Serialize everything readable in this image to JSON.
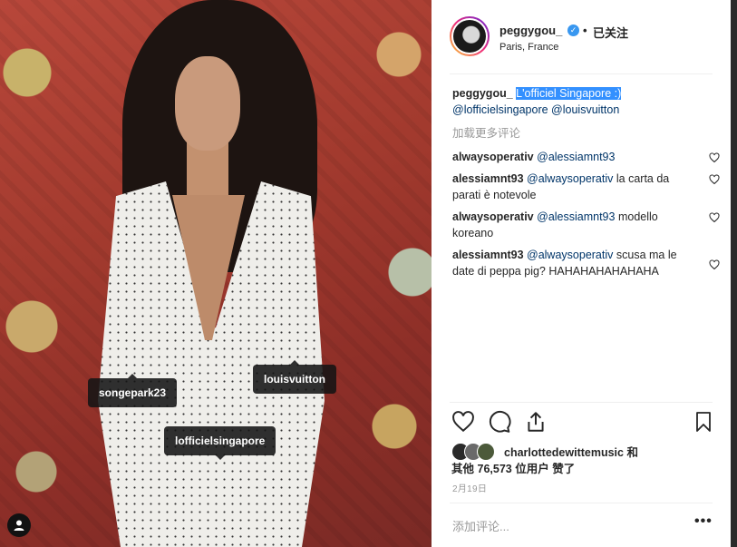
{
  "photo": {
    "tags": [
      {
        "label": "songepark23"
      },
      {
        "label": "louisvuitton"
      },
      {
        "label": "lofficielsingapore"
      }
    ],
    "user_icon": "user-tag-icon"
  },
  "header": {
    "username": "peggygou_",
    "verified_icon": "verified-badge-icon",
    "separator": "•",
    "follow_label": "已关注",
    "location": "Paris, France"
  },
  "caption": {
    "username": "peggygou_",
    "text_selected": "L'officiel Singapore :)",
    "mentions": "@lofficielsingapore @louisvuitton"
  },
  "load_more": "加载更多评论",
  "comments": [
    {
      "user": "alwaysoperativ",
      "text": "@alessiamnt93"
    },
    {
      "user": "alessiamnt93",
      "mention": "@alwaysoperativ",
      "text": "la carta da parati è notevole"
    },
    {
      "user": "alwaysoperativ",
      "mention": "@alessiamnt93",
      "text": "modello koreano"
    },
    {
      "user": "alessiamnt93",
      "mention": "@alwaysoperativ",
      "text": "scusa ma le date di peppa pig? HAHAHAHAHAHAHA"
    }
  ],
  "actions": {
    "like_icon": "heart-icon",
    "comment_icon": "comment-icon",
    "share_icon": "share-icon",
    "save_icon": "bookmark-icon"
  },
  "likes": {
    "first_liker": "charlottedewittemusic",
    "and": "和",
    "others_prefix": "其他",
    "count": "76,573",
    "others_suffix": "位用户 赞了"
  },
  "date": "2月19日",
  "add_comment_placeholder": "添加评论...",
  "more_label": "•••"
}
